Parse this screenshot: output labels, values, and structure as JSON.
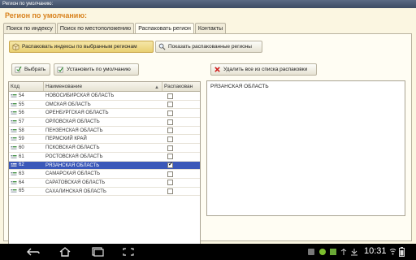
{
  "window": {
    "title": "Регион по умолчанию:"
  },
  "header": {
    "title": "Регион по умолчанию:"
  },
  "tabs": [
    {
      "label": "Поиск по индексу",
      "active": false
    },
    {
      "label": "Поиск по местоположению",
      "active": false
    },
    {
      "label": "Распаковать регион",
      "active": true
    },
    {
      "label": "Контакты",
      "active": false
    }
  ],
  "toolbar": {
    "unpack_selected": "Распаковать индексы по выбранным регионам",
    "show_unpacked": "Показать распакованные регионы",
    "select": "Выбрать",
    "set_default": "Установить по умолчанию",
    "remove_all": "Удалить все из списка распаковки"
  },
  "grid": {
    "headers": {
      "code": "Код",
      "name": "Наименование",
      "unpacked": "Распакован"
    },
    "rows": [
      {
        "code": "54",
        "name": "НОВОСИБИРСКАЯ ОБЛАСТЬ",
        "checked": false,
        "selected": false
      },
      {
        "code": "55",
        "name": "ОМСКАЯ ОБЛАСТЬ",
        "checked": false,
        "selected": false
      },
      {
        "code": "56",
        "name": "ОРЕНБУРГСКАЯ ОБЛАСТЬ",
        "checked": false,
        "selected": false
      },
      {
        "code": "57",
        "name": "ОРЛОВСКАЯ ОБЛАСТЬ",
        "checked": false,
        "selected": false
      },
      {
        "code": "58",
        "name": "ПЕНЗЕНСКАЯ ОБЛАСТЬ",
        "checked": false,
        "selected": false
      },
      {
        "code": "59",
        "name": "ПЕРМСКИЙ КРАЙ",
        "checked": false,
        "selected": false
      },
      {
        "code": "60",
        "name": "ПСКОВСКАЯ ОБЛАСТЬ",
        "checked": false,
        "selected": false
      },
      {
        "code": "61",
        "name": "РОСТОВСКАЯ ОБЛАСТЬ",
        "checked": false,
        "selected": false
      },
      {
        "code": "62",
        "name": "РЯЗАНСКАЯ ОБЛАСТЬ",
        "checked": true,
        "selected": true
      },
      {
        "code": "63",
        "name": "САМАРСКАЯ ОБЛАСТЬ",
        "checked": false,
        "selected": false
      },
      {
        "code": "64",
        "name": "САРАТОВСКАЯ ОБЛАСТЬ",
        "checked": false,
        "selected": false
      },
      {
        "code": "65",
        "name": "САХАЛИНСКАЯ ОБЛАСТЬ",
        "checked": false,
        "selected": false
      }
    ]
  },
  "unpack_list": {
    "items": [
      "РЯЗАНСКАЯ ОБЛАСТЬ"
    ]
  },
  "statusbar": {
    "time": "10:31"
  },
  "colors": {
    "accent": "#d8821e",
    "selection": "#3b58b9",
    "background": "#fbf6e1"
  }
}
